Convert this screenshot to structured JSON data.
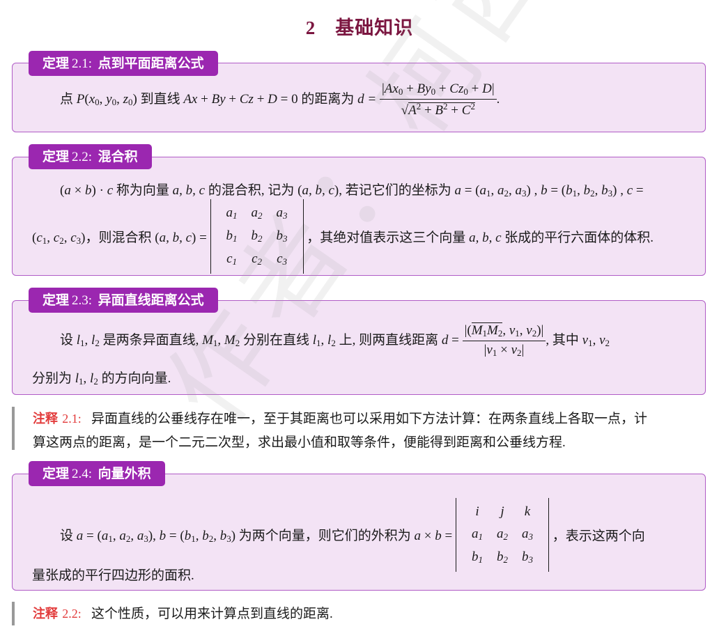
{
  "section": {
    "number": "2",
    "title": "基础知识"
  },
  "theorems": [
    {
      "prefix": "定理",
      "num": "2.1:",
      "name": "点到平面距离公式"
    },
    {
      "prefix": "定理",
      "num": "2.2:",
      "name": "混合积"
    },
    {
      "prefix": "定理",
      "num": "2.3:",
      "name": "异面直线距离公式"
    },
    {
      "prefix": "定理",
      "num": "2.4:",
      "name": "向量外积"
    }
  ],
  "t1": {
    "text_a": "点 ",
    "text_b": " 到直线 ",
    "text_c": " 的距离为 ",
    "formula_d": "d ="
  },
  "t2": {
    "text_a": " 称为向量 ",
    "text_b": " 的混合积, 记为 ",
    "text_c": ", 若记它们的坐标为 ",
    "text_d": "，则混合积 ",
    "text_e": "，其绝对值表示这三个向量 ",
    "text_f": " 张成的平行六面体的体积."
  },
  "t3": {
    "text_a": "设 ",
    "text_b": " 是两条异面直线, ",
    "text_c": " 分别在直线 ",
    "text_d": " 上, 则两直线距离 ",
    "text_e": ", 其中 ",
    "text_f": "分别为 ",
    "text_g": " 的方向向量."
  },
  "remark1": {
    "label": "注释",
    "num": "2.1:",
    "line1": "异面直线的公垂线存在唯一，至于其距离也可以采用如下方法计算：在两条直线上各取一点，计",
    "line2": "算这两点的距离，是一个二元二次型，求出最小值和取等条件，便能得到距离和公垂线方程."
  },
  "t4": {
    "text_a": "设 ",
    "text_b": " 为两个向量，则它们的外积为 ",
    "text_c": "，表示这两个向",
    "text_d": "量张成的平行四边形的面积."
  },
  "remark2": {
    "label": "注释",
    "num": "2.2:",
    "text": "这个性质，可以用来计算点到直线的距离."
  },
  "watermark": "作者：柯西不远爱你",
  "colors": {
    "title": "#7b1640",
    "label_bg": "#9b27b0",
    "box_bg": "#f3e3f5",
    "box_border": "#b05bc6",
    "remark_label": "#e23b3b"
  }
}
